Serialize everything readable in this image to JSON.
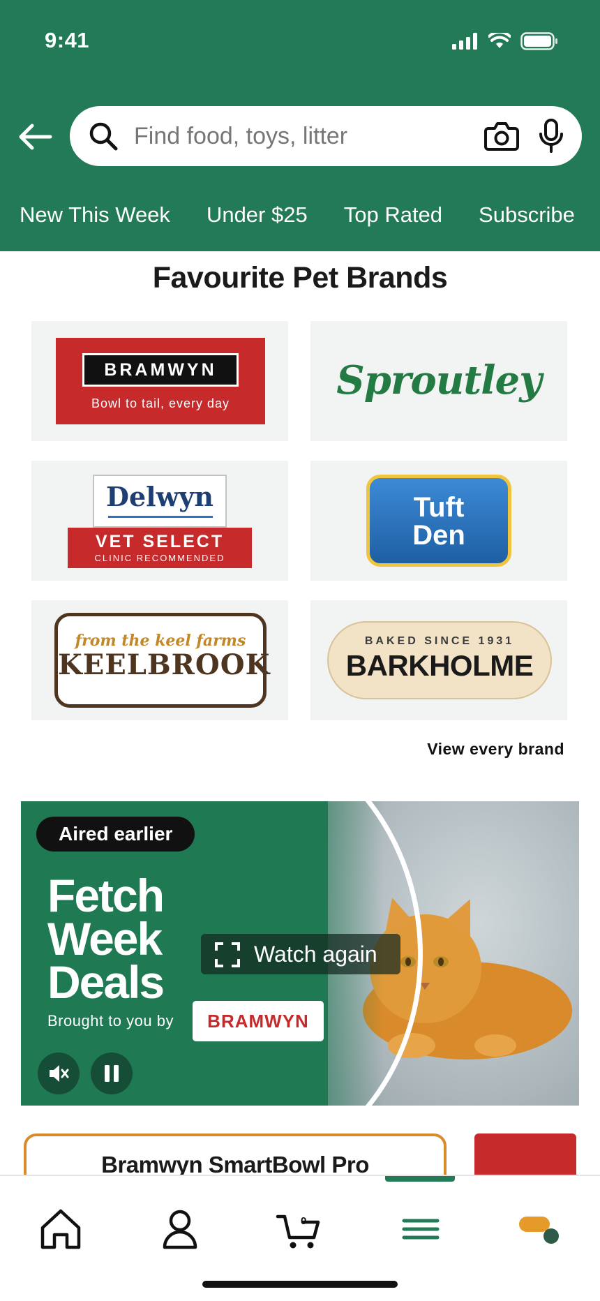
{
  "status_bar": {
    "time": "9:41"
  },
  "search": {
    "placeholder": "Find food, toys, litter"
  },
  "quick_links": [
    "New This Week",
    "Under $25",
    "Top Rated",
    "Subscribe"
  ],
  "brands": {
    "title": "Favourite Pet Brands",
    "bramwyn": {
      "name": "BRAMWYN",
      "tagline": "Bowl to tail, every day"
    },
    "sproutley": {
      "name": "Sproutley"
    },
    "delwyn": {
      "name": "Delwyn",
      "line1": "VET SELECT",
      "line2": "CLINIC RECOMMENDED"
    },
    "tuft_den": {
      "line1": "Tuft",
      "line2": "Den"
    },
    "keelbrook": {
      "tagline": "from the keel farms",
      "name": "KEELBROOK"
    },
    "barkholme": {
      "tagline": "BAKED SINCE 1931",
      "name": "BARKHOLME"
    },
    "view_all": "View every brand"
  },
  "promo": {
    "badge": "Aired earlier",
    "title_line1": "Fetch",
    "title_line2": "Week",
    "title_line3": "Deals",
    "sponsor_prefix": "Brought to you by",
    "sponsor_brand": "BRAMWYN",
    "watch_label": "Watch again"
  },
  "product_peek": {
    "title": "Bramwyn SmartBowl Pro"
  },
  "bottom_nav": {
    "items": [
      "home-icon",
      "account-icon",
      "cart-icon",
      "menu-icon",
      "assistant-icon"
    ],
    "cart_count": "0",
    "active": "menu-icon"
  },
  "colors": {
    "brand_green": "#237a57",
    "brand_red": "#c62a2b",
    "accent_orange": "#d98b2b"
  }
}
